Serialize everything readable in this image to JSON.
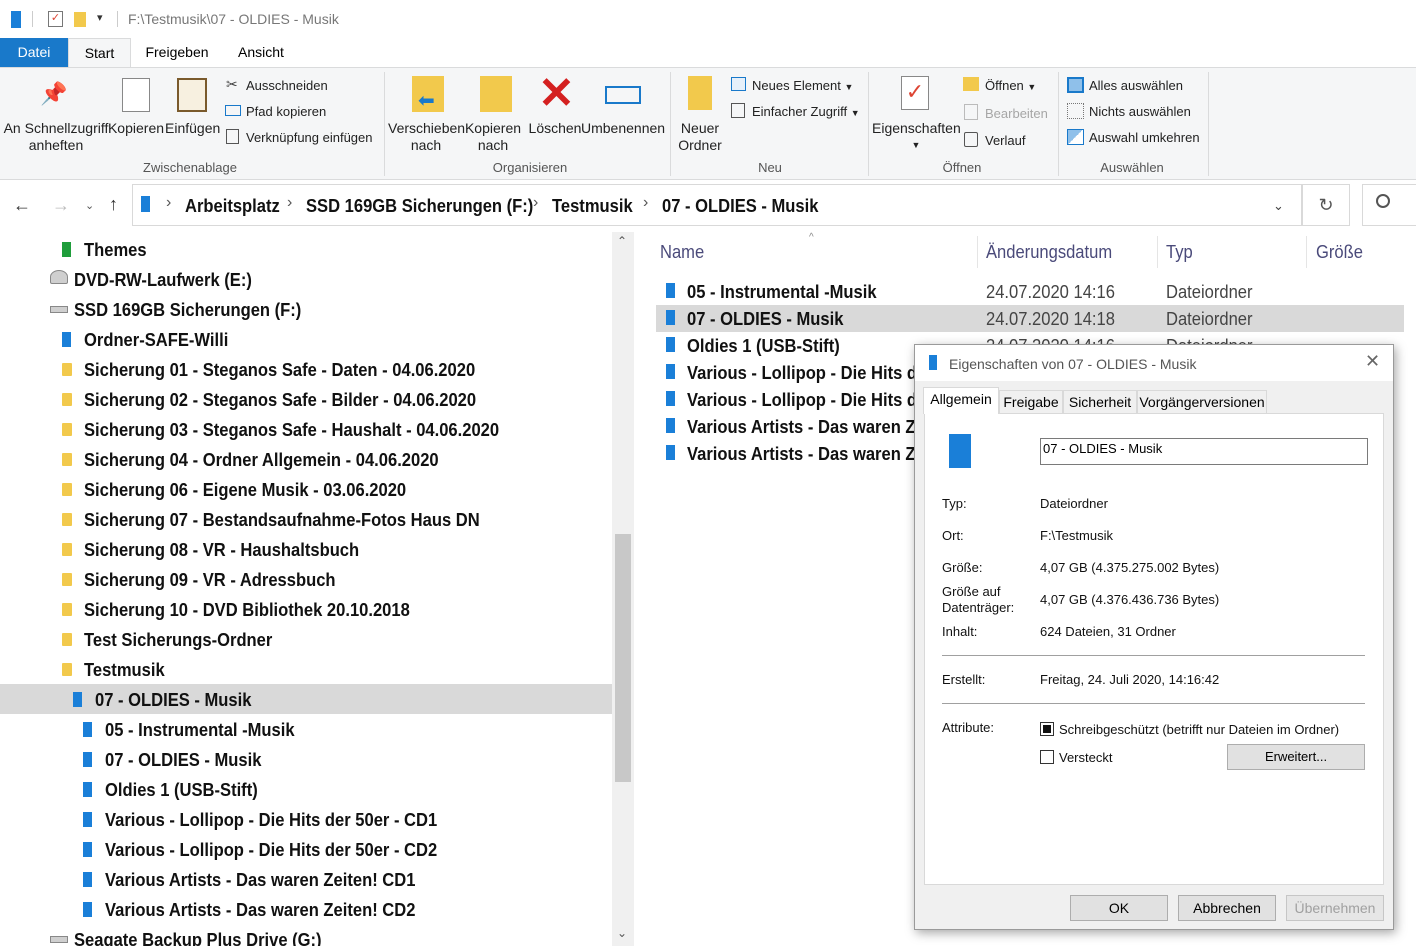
{
  "window": {
    "title": "F:\\Testmusik\\07 - OLDIES - Musik"
  },
  "menu_tabs": [
    "Datei",
    "Start",
    "Freigeben",
    "Ansicht"
  ],
  "ribbon": {
    "clipboard": {
      "pin_label_1": "An Schnellzugriff",
      "pin_label_2": "anheften",
      "copy": "Kopieren",
      "paste": "Einfügen",
      "cut": "Ausschneiden",
      "copy_path": "Pfad kopieren",
      "paste_link": "Verknüpfung einfügen",
      "group": "Zwischenablage"
    },
    "organize": {
      "move_1": "Verschieben",
      "move_2": "nach",
      "copyto_1": "Kopieren",
      "copyto_2": "nach",
      "delete": "Löschen",
      "rename": "Umbenennen",
      "group": "Organisieren"
    },
    "new": {
      "new_folder_1": "Neuer",
      "new_folder_2": "Ordner",
      "new_item": "Neues Element",
      "easy_access": "Einfacher Zugriff",
      "group": "Neu"
    },
    "open": {
      "properties": "Eigenschaften",
      "open": "Öffnen",
      "edit": "Bearbeiten",
      "history": "Verlauf",
      "group": "Öffnen"
    },
    "select": {
      "select_all": "Alles auswählen",
      "select_none": "Nichts auswählen",
      "invert": "Auswahl umkehren",
      "group": "Auswählen"
    }
  },
  "address": {
    "crumbs": [
      "Arbeitsplatz",
      "SSD 169GB Sicherungen (F:)",
      "Testmusik",
      "07 - OLDIES - Musik"
    ]
  },
  "tree": [
    {
      "label": "Themes",
      "icon": "folder-green"
    },
    {
      "label": "DVD-RW-Laufwerk (E:)",
      "icon": "dvd-drive"
    },
    {
      "label": "SSD 169GB Sicherungen (F:)",
      "icon": "drive"
    },
    {
      "label": "Ordner-SAFE-Willi",
      "icon": "folder-blue"
    },
    {
      "label": "Sicherung 01 - Steganos Safe - Daten - 04.06.2020",
      "icon": "folder-yellow"
    },
    {
      "label": "Sicherung 02 - Steganos Safe - Bilder - 04.06.2020",
      "icon": "folder-yellow"
    },
    {
      "label": "Sicherung 03 - Steganos Safe - Haushalt - 04.06.2020",
      "icon": "folder-yellow"
    },
    {
      "label": "Sicherung 04 - Ordner Allgemein - 04.06.2020",
      "icon": "folder-yellow"
    },
    {
      "label": "Sicherung 06 - Eigene Musik - 03.06.2020",
      "icon": "folder-yellow"
    },
    {
      "label": "Sicherung 07 - Bestandsaufnahme-Fotos Haus DN",
      "icon": "folder-yellow"
    },
    {
      "label": "Sicherung 08 - VR - Haushaltsbuch",
      "icon": "folder-yellow"
    },
    {
      "label": "Sicherung 09 - VR - Adressbuch",
      "icon": "folder-yellow"
    },
    {
      "label": "Sicherung 10 - DVD Bibliothek 20.10.2018",
      "icon": "folder-yellow"
    },
    {
      "label": "Test Sicherungs-Ordner",
      "icon": "folder-yellow"
    },
    {
      "label": "Testmusik",
      "icon": "folder-yellow"
    },
    {
      "label": "07 - OLDIES - Musik",
      "icon": "folder-blue",
      "selected": true
    },
    {
      "label": "05 - Instrumental -Musik",
      "icon": "folder-blue"
    },
    {
      "label": "07 - OLDIES - Musik",
      "icon": "folder-blue"
    },
    {
      "label": "Oldies 1 (USB-Stift)",
      "icon": "folder-blue"
    },
    {
      "label": "Various - Lollipop - Die Hits der 50er - CD1",
      "icon": "folder-blue"
    },
    {
      "label": "Various - Lollipop - Die Hits der 50er - CD2",
      "icon": "folder-blue"
    },
    {
      "label": "Various Artists - Das waren Zeiten!  CD1",
      "icon": "folder-blue"
    },
    {
      "label": "Various Artists - Das waren Zeiten!  CD2",
      "icon": "folder-blue"
    },
    {
      "label": "Seagate Backup Plus Drive (G:)",
      "icon": "drive"
    }
  ],
  "files": {
    "headers": {
      "name": "Name",
      "date": "Änderungsdatum",
      "type": "Typ",
      "size": "Größe"
    },
    "rows": [
      {
        "name": "05 - Instrumental -Musik",
        "date": "24.07.2020 14:16",
        "type": "Dateiordner"
      },
      {
        "name": "07 - OLDIES - Musik",
        "date": "24.07.2020 14:18",
        "type": "Dateiordner",
        "selected": true
      },
      {
        "name": "Oldies 1 (USB-Stift)",
        "date": "24.07.2020 14:16",
        "type": "Dateiordner"
      },
      {
        "name": "Various - Lollipop - Die Hits der 50er - CD1",
        "date": "",
        "type": ""
      },
      {
        "name": "Various - Lollipop - Die Hits der 50er - CD2",
        "date": "",
        "type": ""
      },
      {
        "name": "Various Artists - Das waren Zeiten!  CD1",
        "date": "",
        "type": ""
      },
      {
        "name": "Various Artists - Das waren Zeiten!  CD2",
        "date": "",
        "type": ""
      }
    ]
  },
  "dialog": {
    "title": "Eigenschaften von 07 - OLDIES - Musik",
    "tabs": [
      "Allgemein",
      "Freigabe",
      "Sicherheit",
      "Vorgängerversionen"
    ],
    "name_value": "07 - OLDIES - Musik",
    "type_label": "Typ:",
    "type_value": "Dateiordner",
    "location_label": "Ort:",
    "location_value": "F:\\Testmusik",
    "size_label": "Größe:",
    "size_value": "4,07 GB (4.375.275.002 Bytes)",
    "disk_size_label_1": "Größe auf",
    "disk_size_label_2": "Datenträger:",
    "disk_size_value": "4,07 GB (4.376.436.736 Bytes)",
    "contents_label": "Inhalt:",
    "contents_value": "624 Dateien, 31 Ordner",
    "created_label": "Erstellt:",
    "created_value": "Freitag, 24. Juli 2020, 14:16:42",
    "attributes_label": "Attribute:",
    "readonly_label": "Schreibgeschützt (betrifft nur Dateien im Ordner)",
    "hidden_label": "Versteckt",
    "advanced_button": "Erweitert...",
    "ok": "OK",
    "cancel": "Abbrechen",
    "apply": "Übernehmen"
  },
  "colors": {
    "accent": "#1979ca",
    "folder_blue": "#1a7fd8",
    "folder_yellow": "#f2c94c",
    "selection": "#d9d9d9"
  }
}
